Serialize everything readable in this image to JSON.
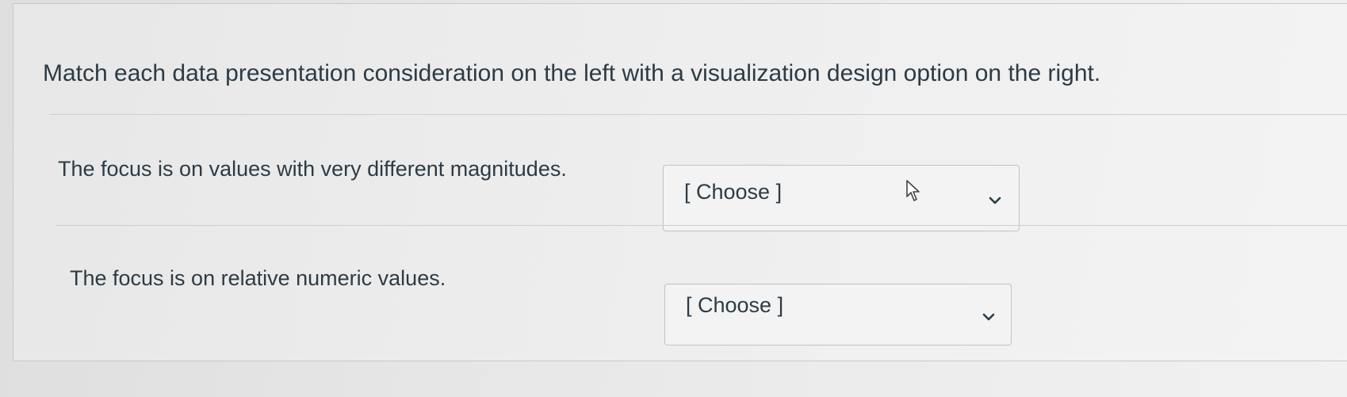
{
  "question": {
    "text": "Match each data presentation consideration on the left with a visualization design option on the right."
  },
  "items": [
    {
      "prompt": "The focus is on values with very different magnitudes.",
      "dropdown_value": "[ Choose ]"
    },
    {
      "prompt": "The focus is on relative numeric values.",
      "dropdown_value": "[ Choose ]"
    }
  ],
  "icons": {
    "dropdown": "chevron-down-icon",
    "pointer": "mouse-cursor-icon"
  },
  "colors": {
    "text": "#2d3b45",
    "border": "#c2c2c2",
    "background": "#e6e6e6"
  }
}
